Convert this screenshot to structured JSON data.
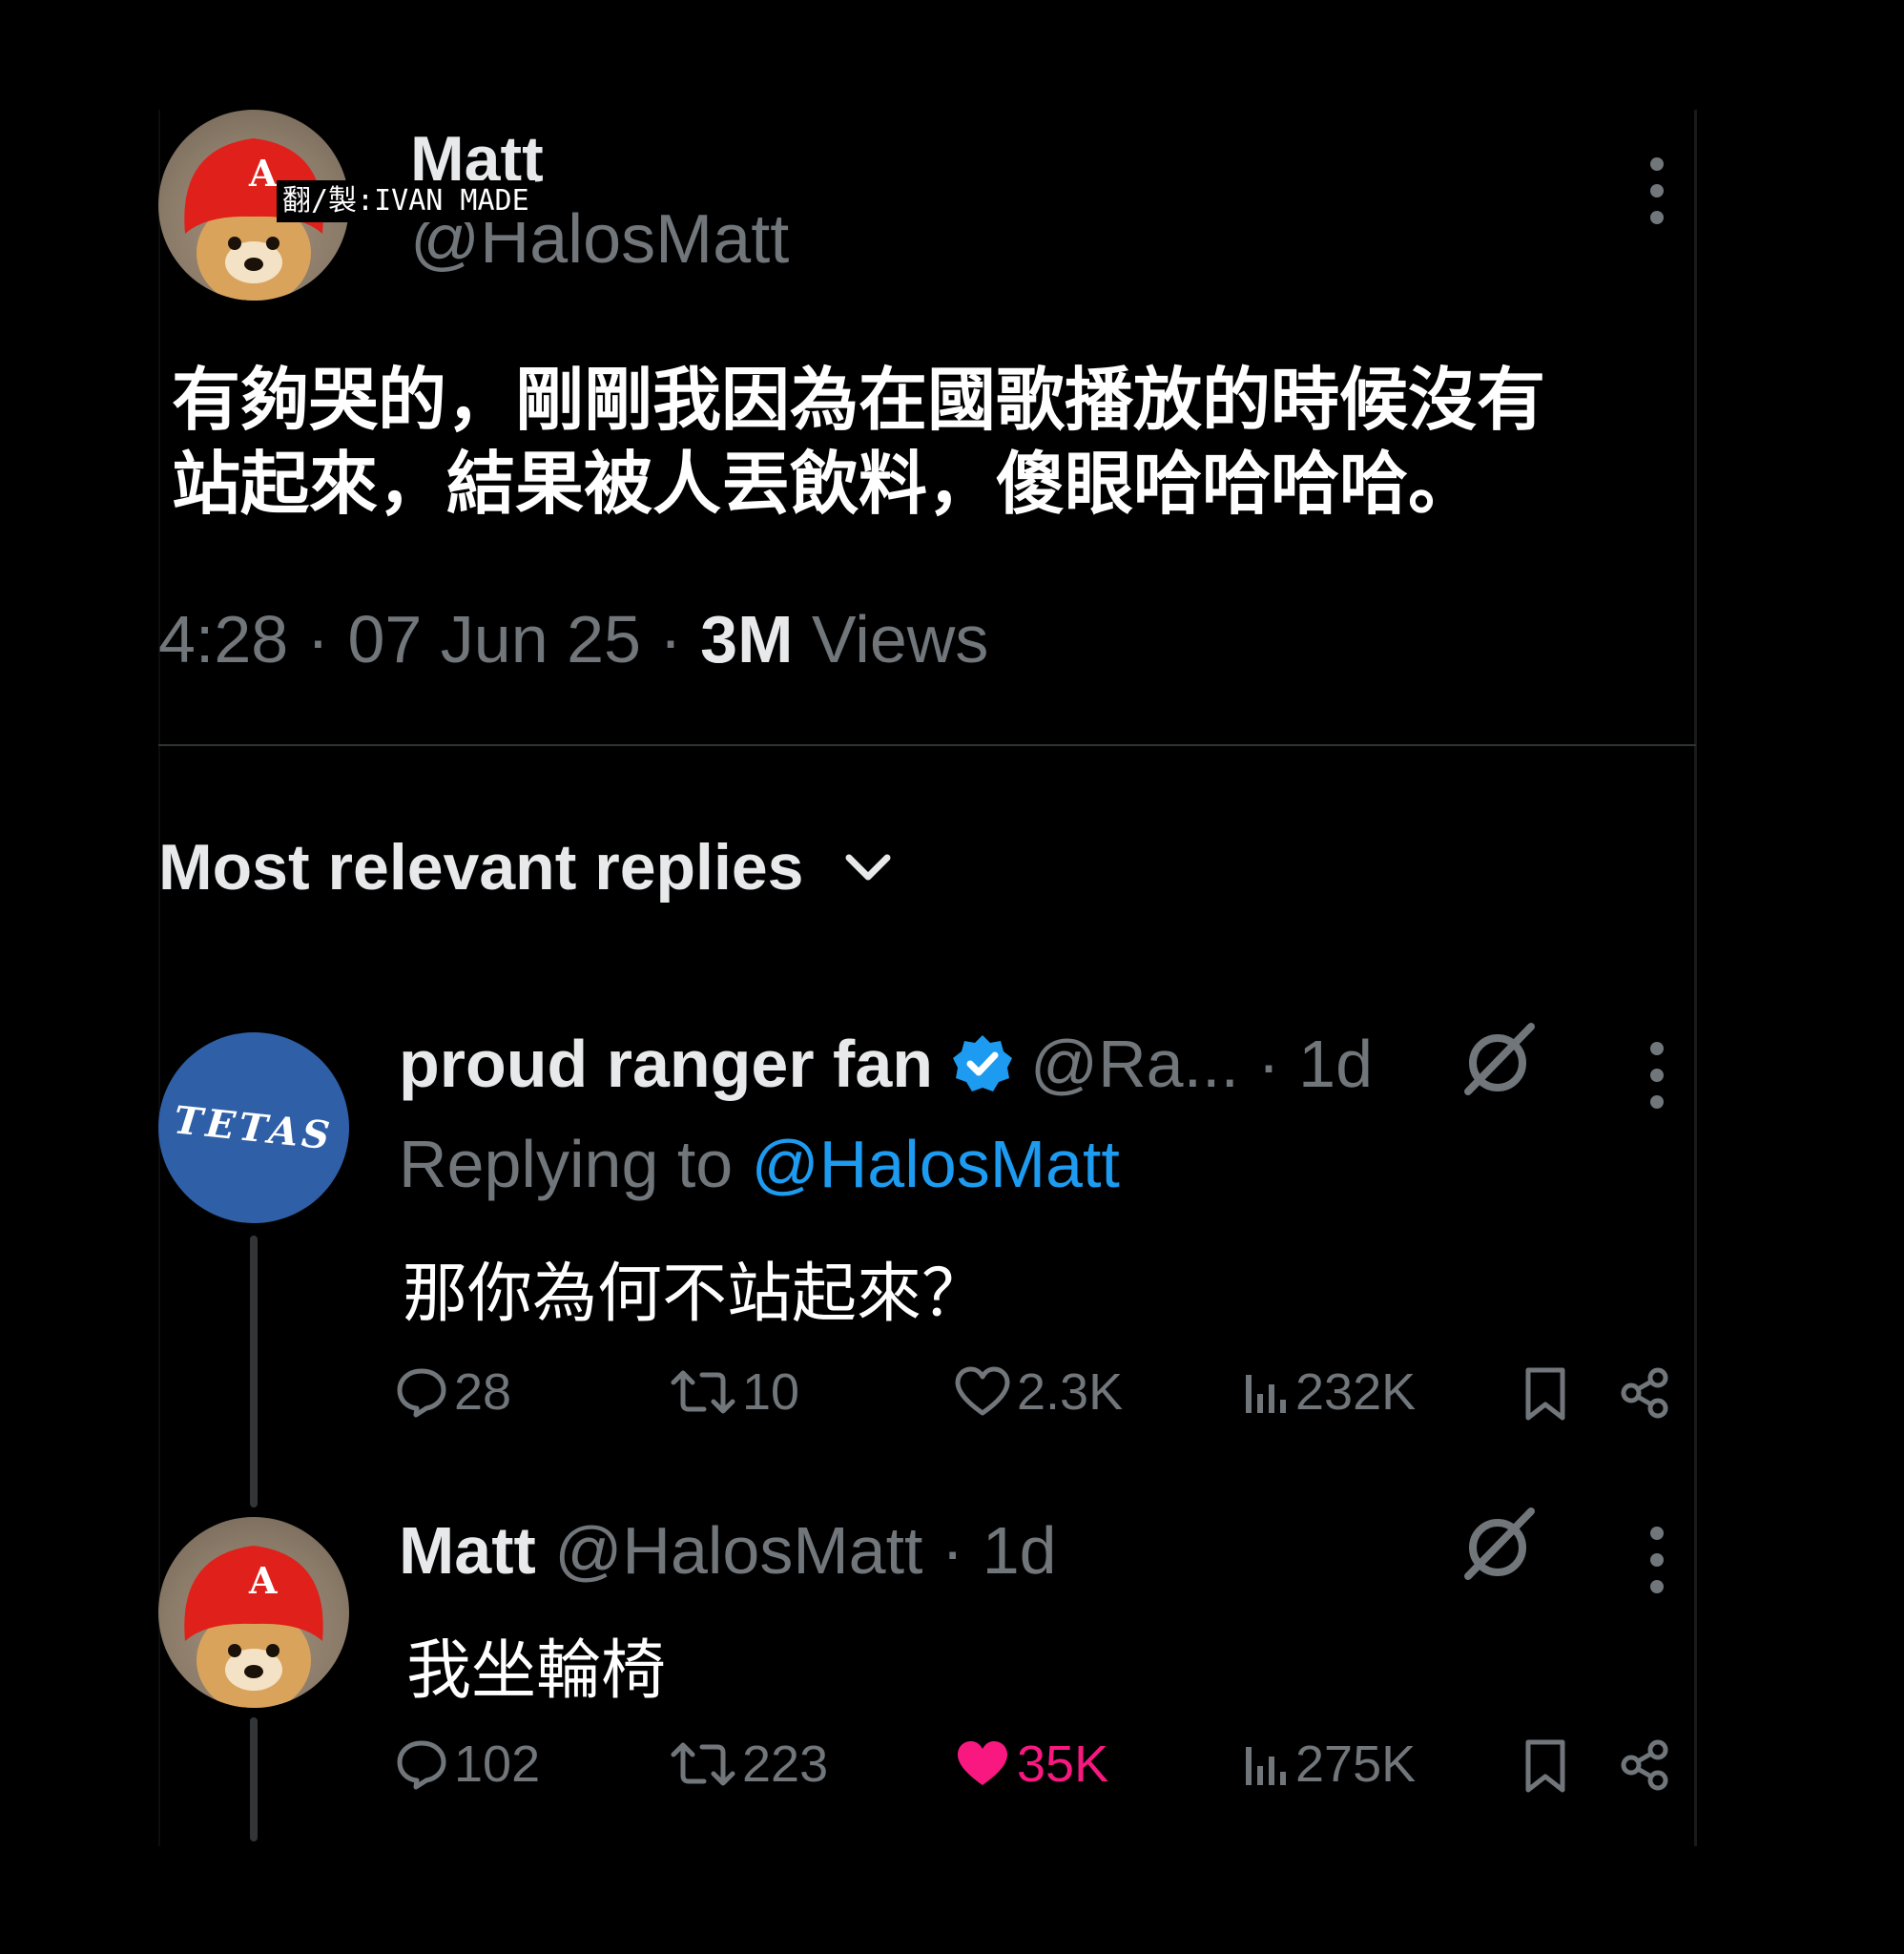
{
  "post": {
    "author_name": "Matt",
    "author_handle": "@HalosMatt",
    "watermark": "翻/製:IVAN MADE",
    "text_line1": "有夠哭的，剛剛我因為在國歌播放的時候沒有",
    "text_line2": "站起來，結果被人丟飲料，傻眼哈哈哈哈。",
    "time": "4:28",
    "date": "07 Jun 25",
    "views_count": "3M",
    "views_label": "Views"
  },
  "replies_header": {
    "label": "Most relevant replies"
  },
  "replies": [
    {
      "author_name": "proud ranger fan",
      "author_handle": "@Ra...",
      "time": "1d",
      "replying_prefix": "Replying to",
      "replying_handle": "@HalosMatt",
      "avatar_text": "TETAS",
      "text": "那你為何不站起來？",
      "comments": "28",
      "reposts": "10",
      "likes": "2.3K",
      "views": "232K",
      "liked": false
    },
    {
      "author_name": "Matt",
      "author_handle": "@HalosMatt",
      "time": "1d",
      "text": "我坐輪椅",
      "comments": "102",
      "reposts": "223",
      "likes": "35K",
      "views": "275K",
      "liked": true
    }
  ],
  "colors": {
    "background": "#000000",
    "text_primary": "#e7e9ea",
    "text_muted": "#71767b",
    "link": "#1d9bf0",
    "like_active": "#f91880",
    "verified": "#1d9bf0"
  },
  "icons": [
    "more-icon",
    "chevron-down-icon",
    "verified-icon",
    "grok-icon",
    "comment-icon",
    "repost-icon",
    "like-icon",
    "views-icon",
    "bookmark-icon",
    "share-icon"
  ]
}
